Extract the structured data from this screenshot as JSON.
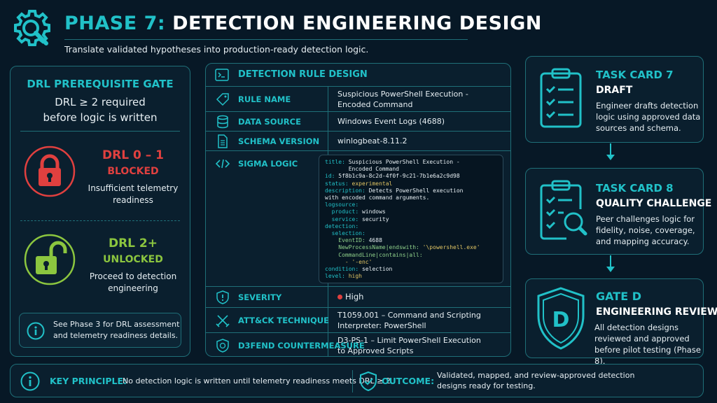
{
  "header": {
    "title_prefix": "PHASE 7:",
    "title_main": "DETECTION ENGINEERING DESIGN",
    "subtitle": "Translate validated hypotheses into production-ready detection logic.",
    "icon": "gear-magnifier-icon"
  },
  "gate": {
    "title": "DRL PREREQUISITE GATE",
    "requirement_line1": "DRL ≥ 2 required",
    "requirement_line2": "before logic is written",
    "blocked": {
      "title": "DRL 0 – 1",
      "status": "BLOCKED",
      "desc_line1": "Insufficient telemetry",
      "desc_line2": "readiness",
      "color": "#e0403f",
      "icon": "locked-padlock-icon"
    },
    "unlocked": {
      "title": "DRL 2+",
      "status": "UNLOCKED",
      "desc_line1": "Proceed to detection",
      "desc_line2": "engineering",
      "color": "#8cc63f",
      "icon": "unlocked-padlock-icon"
    },
    "note_line1": "See Phase 3 for DRL assessment",
    "note_line2": "and telemetry readiness details."
  },
  "rule": {
    "header": "DETECTION RULE DESIGN",
    "rows": {
      "rule_name": {
        "label": "RULE NAME",
        "value_line1": "Suspicious PowerShell Execution -",
        "value_line2": "Encoded Command"
      },
      "data_source": {
        "label": "DATA SOURCE",
        "value": "Windows Event Logs (4688)"
      },
      "schema_version": {
        "label": "SCHEMA VERSION",
        "value": "winlogbeat-8.11.2"
      },
      "sigma_logic": {
        "label": "SIGMA LOGIC"
      },
      "severity": {
        "label": "SEVERITY",
        "value": "High",
        "dot_color": "#e0403f"
      },
      "attack": {
        "label": "ATT&CK TECHNIQUE",
        "value_line1": "T1059.001 – Command and Scripting",
        "value_line2": "Interpreter: PowerShell"
      },
      "d3fend": {
        "label": "D3FEND COUNTERMEASURE",
        "value_line1": "D3-PS-1 – Limit PowerShell Execution",
        "value_line2": "to Approved Scripts"
      }
    },
    "sigma": {
      "k_title": "title:",
      "v_title1": " Suspicious PowerShell Execution -",
      "v_title2": "       Encoded Command",
      "k_id": "id:",
      "v_id": " 5f8b1c9a-8c2d-4f0f-9c21-7b1e6a2c9d98",
      "k_status": "status:",
      "v_status": " experimental",
      "k_desc": "description:",
      "v_desc1": " Detects PowerShell execution",
      "v_desc2": "with encoded command arguments.",
      "k_logsource": "logsource:",
      "k_product": "  product:",
      "v_product": " windows",
      "k_service": "  service:",
      "v_service": " security",
      "k_detection": "detection:",
      "k_selection": "  selection:",
      "k_eventid": "    EventID:",
      "v_eventid": " 4688",
      "k_npn": "    NewProcessName|endswith:",
      "v_npn": " '\\powershell.exe'",
      "k_cmd": "    CommandLine|contains|all:",
      "v_enc": "      - '-enc'",
      "k_condition": "condition:",
      "v_condition": " selection",
      "k_level": "level:",
      "v_level": " high"
    }
  },
  "cards": [
    {
      "title": "TASK CARD 7",
      "subtitle": "DRAFT",
      "desc": "Engineer drafts detection logic using approved data sources and schema.",
      "icon": "clipboard-checklist-icon"
    },
    {
      "title": "TASK CARD 8",
      "subtitle": "QUALITY CHALLENGE",
      "desc": "Peer challenges logic for fidelity, noise, coverage, and mapping accuracy.",
      "icon": "clipboard-magnifier-icon"
    },
    {
      "title": "GATE D",
      "subtitle": "ENGINEERING REVIEW",
      "desc": "All detection designs reviewed and approved before pilot testing (Phase 8).",
      "icon": "shield-d-icon"
    }
  ],
  "footer": {
    "key_label": "KEY PRINCIPLE:",
    "key_text": "No detection logic is written until telemetry readiness meets DRL ≥ 2.",
    "outcome_label": "OUTCOME:",
    "outcome_line1": "Validated, mapped, and review-approved detection",
    "outcome_line2": "designs ready for testing."
  },
  "colors": {
    "accent": "#21c1c8",
    "background": "#071826",
    "border": "#1f6f78",
    "blocked": "#e0403f",
    "unlocked": "#8cc63f"
  }
}
